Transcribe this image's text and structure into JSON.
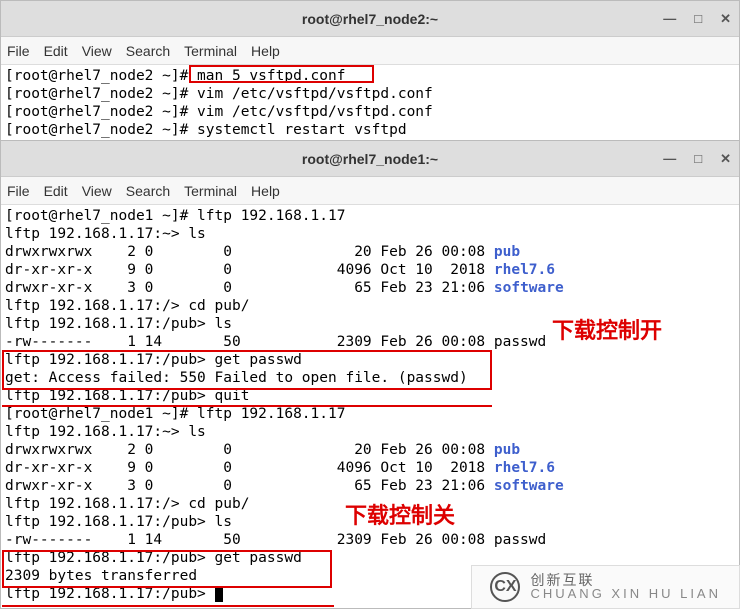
{
  "windows": [
    {
      "title": "root@rhel7_node2:~",
      "menu": [
        "File",
        "Edit",
        "View",
        "Search",
        "Terminal",
        "Help"
      ],
      "lines": [
        {
          "prompt": "[root@rhel7_node2 ~]# ",
          "cmd": "man 5 vsftpd.conf"
        },
        {
          "prompt": "[root@rhel7_node2 ~]# ",
          "cmd": "vim /etc/vsftpd/vsftpd.conf"
        },
        {
          "prompt": "[root@rhel7_node2 ~]# ",
          "cmd": "vim /etc/vsftpd/vsftpd.conf"
        },
        {
          "prompt": "[root@rhel7_node2 ~]# ",
          "cmd": "systemctl restart vsftpd"
        }
      ]
    },
    {
      "title": "root@rhel7_node1:~",
      "menu": [
        "File",
        "Edit",
        "View",
        "Search",
        "Terminal",
        "Help"
      ],
      "lines": [
        "[root@rhel7_node1 ~]# lftp 192.168.1.17",
        "lftp 192.168.1.17:~> ls",
        {
          "t": "drwxrwxrwx    2 0        0              20 Feb 26 00:08 ",
          "link": "pub"
        },
        {
          "t": "dr-xr-xr-x    9 0        0            4096 Oct 10  2018 ",
          "link": "rhel7.6"
        },
        {
          "t": "drwxr-xr-x    3 0        0              65 Feb 23 21:06 ",
          "link": "software"
        },
        "lftp 192.168.1.17:/> cd pub/",
        "lftp 192.168.1.17:/pub> ls",
        "-rw-------    1 14       50           2309 Feb 26 00:08 passwd",
        "lftp 192.168.1.17:/pub> get passwd",
        "get: Access failed: 550 Failed to open file. (passwd)",
        "lftp 192.168.1.17:/pub> quit",
        "[root@rhel7_node1 ~]# lftp 192.168.1.17",
        "lftp 192.168.1.17:~> ls",
        {
          "t": "drwxrwxrwx    2 0        0              20 Feb 26 00:08 ",
          "link": "pub"
        },
        {
          "t": "dr-xr-xr-x    9 0        0            4096 Oct 10  2018 ",
          "link": "rhel7.6"
        },
        {
          "t": "drwxr-xr-x    3 0        0              65 Feb 23 21:06 ",
          "link": "software"
        },
        "lftp 192.168.1.17:/> cd pub/",
        "lftp 192.168.1.17:/pub> ls",
        "-rw-------    1 14       50           2309 Feb 26 00:08 passwd",
        "lftp 192.168.1.17:/pub> get passwd",
        "2309 bytes transferred",
        {
          "cursorLine": true,
          "t": "lftp 192.168.1.17:/pub> "
        }
      ]
    }
  ],
  "controls": {
    "min": "—",
    "max": "□",
    "close": "✕"
  },
  "annotations": {
    "label1": "下载控制开",
    "label2": "下载控制关"
  },
  "watermark": {
    "logo": "CX",
    "cn": "创新互联",
    "en": "CHUANG XIN HU LIAN"
  }
}
